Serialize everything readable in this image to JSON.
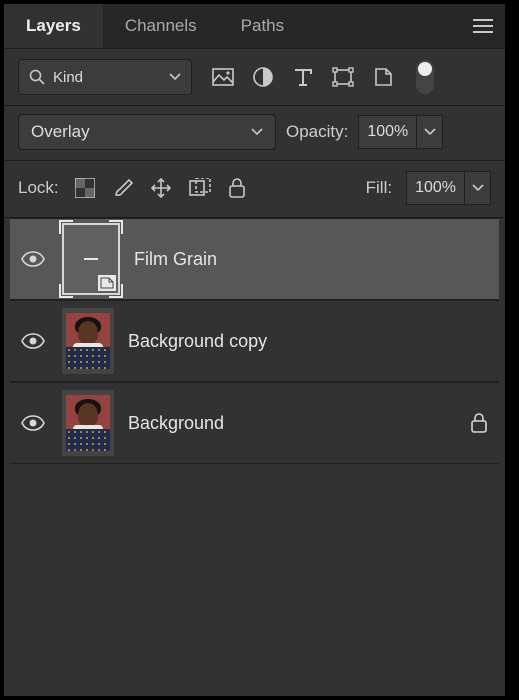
{
  "tabs": {
    "layers": "Layers",
    "channels": "Channels",
    "paths": "Paths"
  },
  "filter": {
    "kind_label": "Kind"
  },
  "blend": {
    "mode": "Overlay",
    "opacity_label": "Opacity:",
    "opacity_value": "100%"
  },
  "lock": {
    "label": "Lock:",
    "fill_label": "Fill:",
    "fill_value": "100%"
  },
  "layers_list": [
    {
      "name": "Film Grain",
      "selected": true,
      "smart_object": true,
      "locked": false
    },
    {
      "name": "Background copy",
      "selected": false,
      "smart_object": false,
      "locked": false
    },
    {
      "name": "Background",
      "selected": false,
      "smart_object": false,
      "locked": true
    }
  ]
}
